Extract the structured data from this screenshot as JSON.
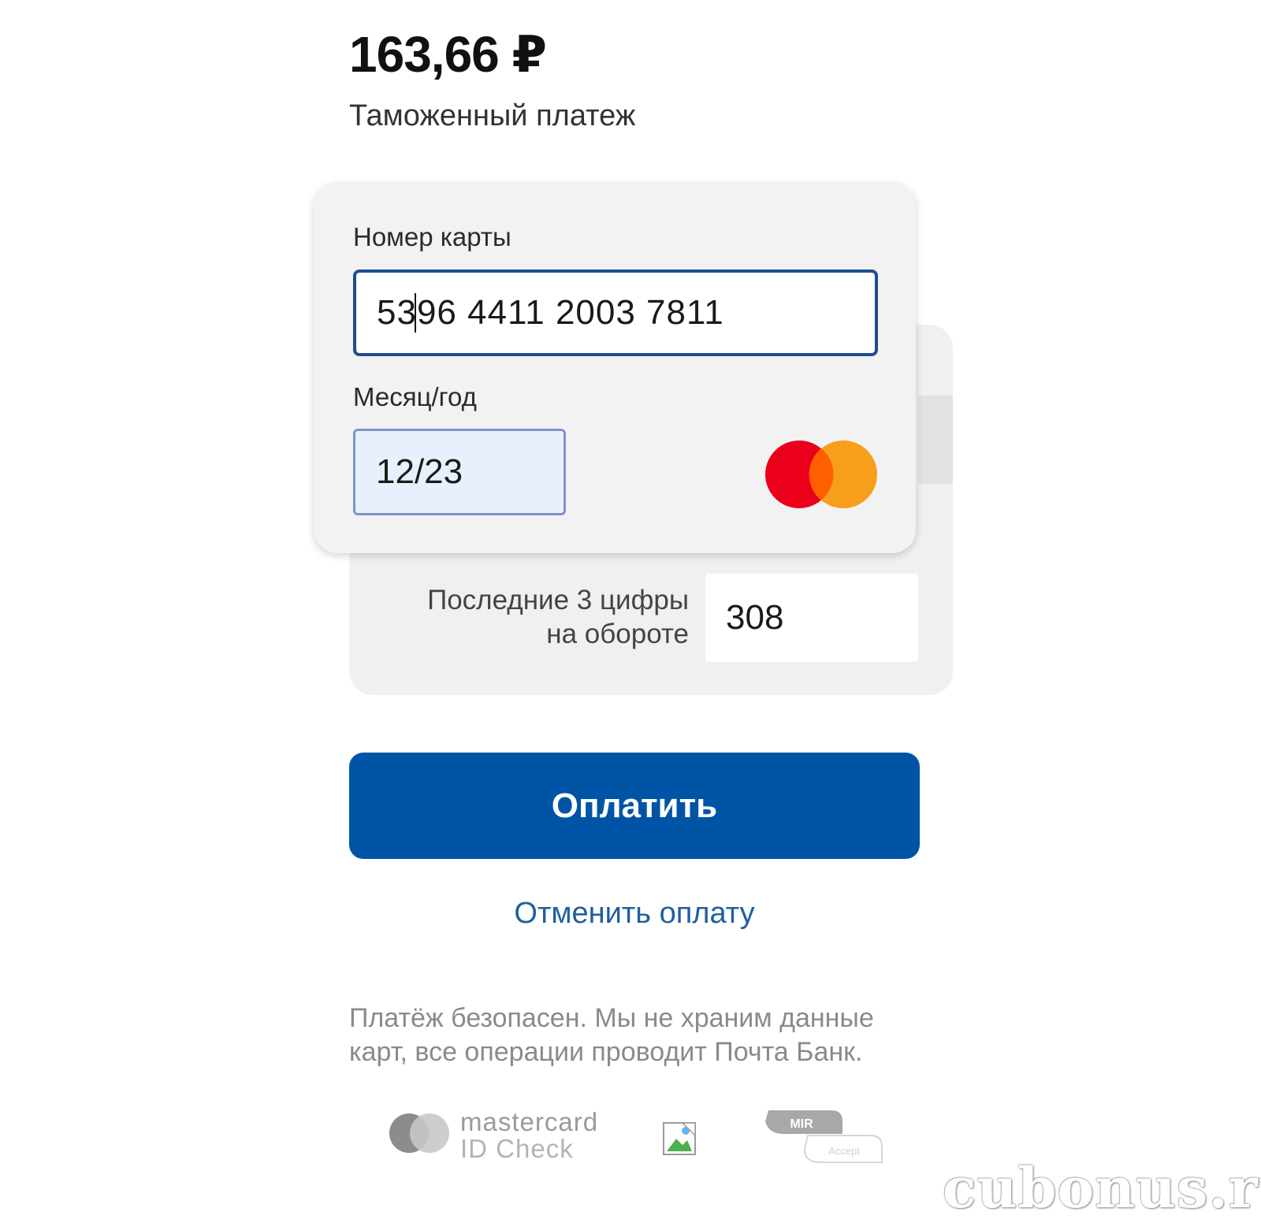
{
  "payment": {
    "amount": "163,66 ₽",
    "purpose": "Таможенный платеж"
  },
  "card_form": {
    "card_number_label": "Номер карты",
    "card_number_value": "5396 4411 2003 7811",
    "expiry_label": "Месяц/год",
    "expiry_value": "12/23",
    "cvv_label_line1": "Последние 3 цифры",
    "cvv_label_line2": "на обороте",
    "cvv_value": "308",
    "card_brand_icon": "mastercard-icon"
  },
  "actions": {
    "pay_label": "Оплатить",
    "cancel_label": "Отменить оплату"
  },
  "security": {
    "line1": "Платёж безопасен. Мы не храним данные",
    "line2": "карт, все операции проводит Почта Банк."
  },
  "badges": {
    "mc_id_line1": "mastercard",
    "mc_id_line2": "ID Check",
    "mir_label": "MIR",
    "mir_sub": "Accept"
  },
  "watermark": "cubonus.ru",
  "colors": {
    "primary": "#0054a6",
    "link": "#1f5fa0",
    "card_bg": "#f2f2f2",
    "mc_red": "#eb001b",
    "mc_orange": "#f79e1b"
  }
}
